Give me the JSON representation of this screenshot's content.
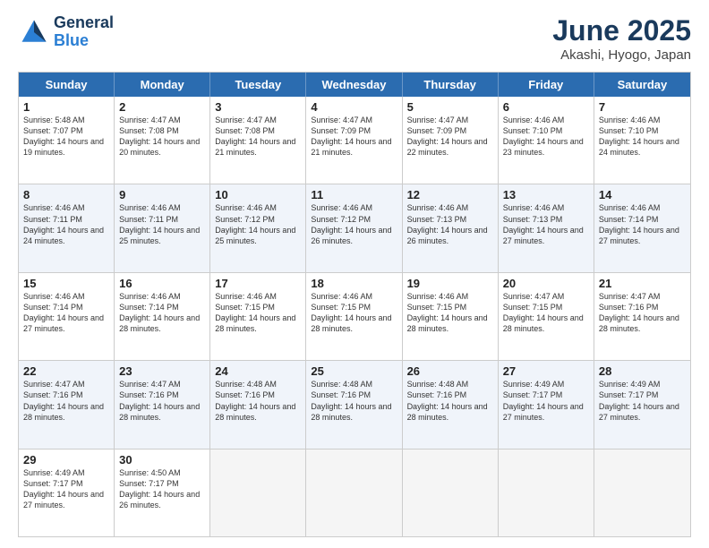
{
  "logo": {
    "line1": "General",
    "line2": "Blue"
  },
  "title": "June 2025",
  "subtitle": "Akashi, Hyogo, Japan",
  "days": [
    "Sunday",
    "Monday",
    "Tuesday",
    "Wednesday",
    "Thursday",
    "Friday",
    "Saturday"
  ],
  "weeks": [
    [
      {
        "day": "1",
        "sunrise": "5:48 AM",
        "sunset": "7:07 PM",
        "daylight": "14 hours and 19 minutes."
      },
      {
        "day": "2",
        "sunrise": "4:47 AM",
        "sunset": "7:08 PM",
        "daylight": "14 hours and 20 minutes."
      },
      {
        "day": "3",
        "sunrise": "4:47 AM",
        "sunset": "7:08 PM",
        "daylight": "14 hours and 21 minutes."
      },
      {
        "day": "4",
        "sunrise": "4:47 AM",
        "sunset": "7:09 PM",
        "daylight": "14 hours and 21 minutes."
      },
      {
        "day": "5",
        "sunrise": "4:47 AM",
        "sunset": "7:09 PM",
        "daylight": "14 hours and 22 minutes."
      },
      {
        "day": "6",
        "sunrise": "4:46 AM",
        "sunset": "7:10 PM",
        "daylight": "14 hours and 23 minutes."
      },
      {
        "day": "7",
        "sunrise": "4:46 AM",
        "sunset": "7:10 PM",
        "daylight": "14 hours and 24 minutes."
      }
    ],
    [
      {
        "day": "8",
        "sunrise": "4:46 AM",
        "sunset": "7:11 PM",
        "daylight": "14 hours and 24 minutes."
      },
      {
        "day": "9",
        "sunrise": "4:46 AM",
        "sunset": "7:11 PM",
        "daylight": "14 hours and 25 minutes."
      },
      {
        "day": "10",
        "sunrise": "4:46 AM",
        "sunset": "7:12 PM",
        "daylight": "14 hours and 25 minutes."
      },
      {
        "day": "11",
        "sunrise": "4:46 AM",
        "sunset": "7:12 PM",
        "daylight": "14 hours and 26 minutes."
      },
      {
        "day": "12",
        "sunrise": "4:46 AM",
        "sunset": "7:13 PM",
        "daylight": "14 hours and 26 minutes."
      },
      {
        "day": "13",
        "sunrise": "4:46 AM",
        "sunset": "7:13 PM",
        "daylight": "14 hours and 27 minutes."
      },
      {
        "day": "14",
        "sunrise": "4:46 AM",
        "sunset": "7:14 PM",
        "daylight": "14 hours and 27 minutes."
      }
    ],
    [
      {
        "day": "15",
        "sunrise": "4:46 AM",
        "sunset": "7:14 PM",
        "daylight": "14 hours and 27 minutes."
      },
      {
        "day": "16",
        "sunrise": "4:46 AM",
        "sunset": "7:14 PM",
        "daylight": "14 hours and 28 minutes."
      },
      {
        "day": "17",
        "sunrise": "4:46 AM",
        "sunset": "7:15 PM",
        "daylight": "14 hours and 28 minutes."
      },
      {
        "day": "18",
        "sunrise": "4:46 AM",
        "sunset": "7:15 PM",
        "daylight": "14 hours and 28 minutes."
      },
      {
        "day": "19",
        "sunrise": "4:46 AM",
        "sunset": "7:15 PM",
        "daylight": "14 hours and 28 minutes."
      },
      {
        "day": "20",
        "sunrise": "4:47 AM",
        "sunset": "7:15 PM",
        "daylight": "14 hours and 28 minutes."
      },
      {
        "day": "21",
        "sunrise": "4:47 AM",
        "sunset": "7:16 PM",
        "daylight": "14 hours and 28 minutes."
      }
    ],
    [
      {
        "day": "22",
        "sunrise": "4:47 AM",
        "sunset": "7:16 PM",
        "daylight": "14 hours and 28 minutes."
      },
      {
        "day": "23",
        "sunrise": "4:47 AM",
        "sunset": "7:16 PM",
        "daylight": "14 hours and 28 minutes."
      },
      {
        "day": "24",
        "sunrise": "4:48 AM",
        "sunset": "7:16 PM",
        "daylight": "14 hours and 28 minutes."
      },
      {
        "day": "25",
        "sunrise": "4:48 AM",
        "sunset": "7:16 PM",
        "daylight": "14 hours and 28 minutes."
      },
      {
        "day": "26",
        "sunrise": "4:48 AM",
        "sunset": "7:16 PM",
        "daylight": "14 hours and 28 minutes."
      },
      {
        "day": "27",
        "sunrise": "4:49 AM",
        "sunset": "7:17 PM",
        "daylight": "14 hours and 27 minutes."
      },
      {
        "day": "28",
        "sunrise": "4:49 AM",
        "sunset": "7:17 PM",
        "daylight": "14 hours and 27 minutes."
      }
    ],
    [
      {
        "day": "29",
        "sunrise": "4:49 AM",
        "sunset": "7:17 PM",
        "daylight": "14 hours and 27 minutes."
      },
      {
        "day": "30",
        "sunrise": "4:50 AM",
        "sunset": "7:17 PM",
        "daylight": "14 hours and 26 minutes."
      },
      {
        "day": "",
        "sunrise": "",
        "sunset": "",
        "daylight": ""
      },
      {
        "day": "",
        "sunrise": "",
        "sunset": "",
        "daylight": ""
      },
      {
        "day": "",
        "sunrise": "",
        "sunset": "",
        "daylight": ""
      },
      {
        "day": "",
        "sunrise": "",
        "sunset": "",
        "daylight": ""
      },
      {
        "day": "",
        "sunrise": "",
        "sunset": "",
        "daylight": ""
      }
    ]
  ]
}
